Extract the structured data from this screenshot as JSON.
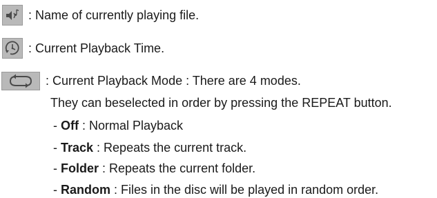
{
  "icons": {
    "file_icon": "speaker-note-icon",
    "time_icon": "clock-icon",
    "mode_icon": "repeat-icon",
    "icon_bg": "#b9b9b9",
    "icon_fg": "#4a4a4a"
  },
  "rows": {
    "file": ": Name of currently playing file.",
    "time": ": Current Playback Time.",
    "mode": ": Current Playback Mode : There are 4 modes."
  },
  "continuation": "They can beselected in order by pressing the REPEAT button.",
  "modes": [
    {
      "term": "Off",
      "desc": " : Normal Playback"
    },
    {
      "term": "Track",
      "desc": " : Repeats the current track."
    },
    {
      "term": "Folder",
      "desc": " : Repeats the current folder."
    },
    {
      "term": "Random",
      "desc": " : Files in the disc will be played in random order."
    }
  ]
}
